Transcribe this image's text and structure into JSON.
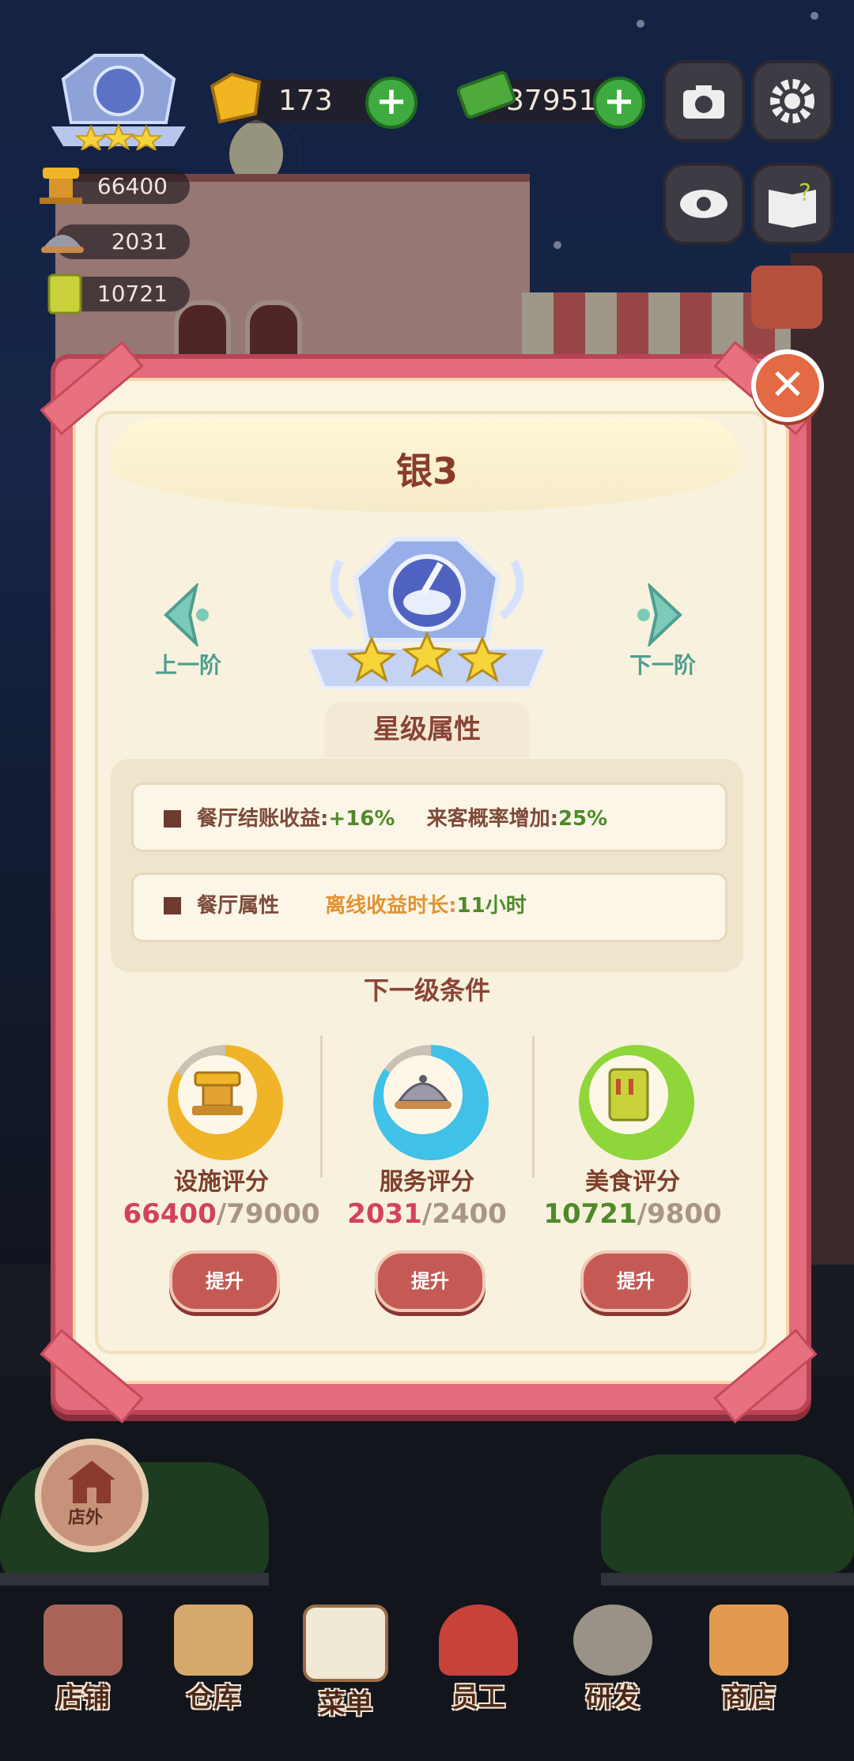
{
  "hud": {
    "gems": "173",
    "cash": "37951",
    "facility_score": "66400",
    "service_score": "2031",
    "food_score": "10721"
  },
  "modal": {
    "title": "银3",
    "prev_label": "上一阶",
    "next_label": "下一阶",
    "star_attr_title": "星级属性",
    "row1_label": "餐厅结账收益:",
    "row1_value": "+16%",
    "row1_label2": "来客概率增加:",
    "row1_value2": "25%",
    "row2_label": "餐厅属性",
    "row2_key": "离线收益时长:",
    "row2_value": "11小时",
    "next_cond_title": "下一级条件",
    "categories": [
      {
        "label": "设施评分",
        "current": "66400",
        "sep_max": "/79000",
        "button": "提升",
        "ring": "#f0b428",
        "progress": 0.84
      },
      {
        "label": "服务评分",
        "current": "2031",
        "sep_max": "/2400",
        "button": "提升",
        "ring": "#3fc1e8",
        "progress": 0.85
      },
      {
        "label": "美食评分",
        "current": "10721",
        "sep_max": "/9800",
        "button": "提升",
        "ring": "#8fd63a",
        "progress": 1.0
      }
    ]
  },
  "outside_label": "店外",
  "nav": [
    {
      "label": "店铺",
      "icon": "shop-icon"
    },
    {
      "label": "仓库",
      "icon": "warehouse-icon"
    },
    {
      "label": "菜单",
      "icon": "menu-icon"
    },
    {
      "label": "员工",
      "icon": "staff-icon"
    },
    {
      "label": "研发",
      "icon": "research-icon"
    },
    {
      "label": "商店",
      "icon": "store-icon"
    }
  ],
  "colors": {
    "frame": "#e36b7b",
    "paper": "#f8f1de",
    "accent_red": "#d2435a",
    "accent_green": "#4f8a2a",
    "button": "#c55a55"
  }
}
